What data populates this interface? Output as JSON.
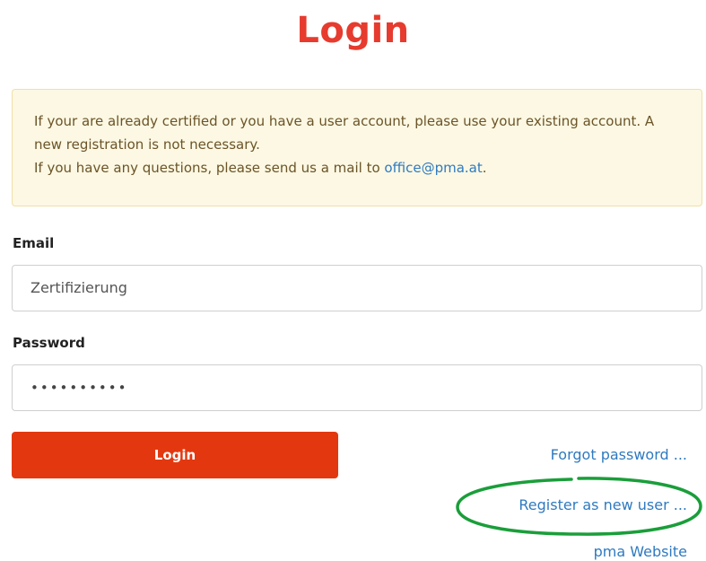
{
  "title": "Login",
  "notice": {
    "line1": "If your are already certified or you have a user account, please use your existing account. A new registration is not necessary.",
    "line2_prefix": "If you have any questions, please send us a mail to ",
    "email_link": "office@pma.at",
    "line2_suffix": "."
  },
  "form": {
    "email_label": "Email",
    "email_value": "Zertifizierung",
    "password_label": "Password",
    "password_value": "••••••••••",
    "login_button": "Login"
  },
  "links": {
    "forgot_password": "Forgot password ...",
    "register": "Register as new user ...",
    "website": "pma Website"
  },
  "colors": {
    "title": "#e63b2e",
    "button": "#e3380f",
    "link": "#2f7ac0",
    "notice_bg": "#fcf8e3",
    "annotation": "#1a9e3a"
  }
}
